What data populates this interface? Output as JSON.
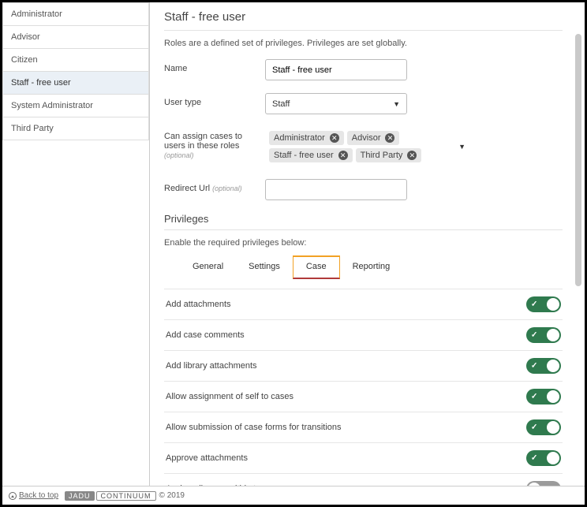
{
  "sidebar": {
    "items": [
      {
        "label": "Administrator",
        "selected": false
      },
      {
        "label": "Advisor",
        "selected": false
      },
      {
        "label": "Citizen",
        "selected": false
      },
      {
        "label": "Staff - free user",
        "selected": true
      },
      {
        "label": "System Administrator",
        "selected": false
      },
      {
        "label": "Third Party",
        "selected": false
      }
    ]
  },
  "main": {
    "title": "Staff - free user",
    "description": "Roles are a defined set of privileges. Privileges are set globally.",
    "labels": {
      "name": "Name",
      "user_type": "User type",
      "assign": "Can assign cases to users in these roles",
      "redirect": "Redirect Url",
      "optional": "(optional)"
    },
    "values": {
      "name": "Staff - free user",
      "user_type": "Staff",
      "redirect": ""
    },
    "assigned_roles": [
      "Administrator",
      "Advisor",
      "Staff - free user",
      "Third Party"
    ]
  },
  "privileges": {
    "title": "Privileges",
    "description": "Enable the required privileges below:",
    "tabs": [
      {
        "label": "General",
        "active": false
      },
      {
        "label": "Settings",
        "active": false
      },
      {
        "label": "Case",
        "active": true
      },
      {
        "label": "Reporting",
        "active": false
      }
    ],
    "items": [
      {
        "label": "Add attachments",
        "on": true
      },
      {
        "label": "Add case comments",
        "on": true
      },
      {
        "label": "Add library attachments",
        "on": true
      },
      {
        "label": "Allow assignment of self to cases",
        "on": true
      },
      {
        "label": "Allow submission of case forms for transitions",
        "on": true
      },
      {
        "label": "Approve attachments",
        "on": true
      },
      {
        "label": "Assign all users within type",
        "on": false
      }
    ]
  },
  "footer": {
    "back": "Back to top",
    "brand1": "JADU",
    "brand2": "CONTINUUM",
    "copyright": "© 2019"
  }
}
